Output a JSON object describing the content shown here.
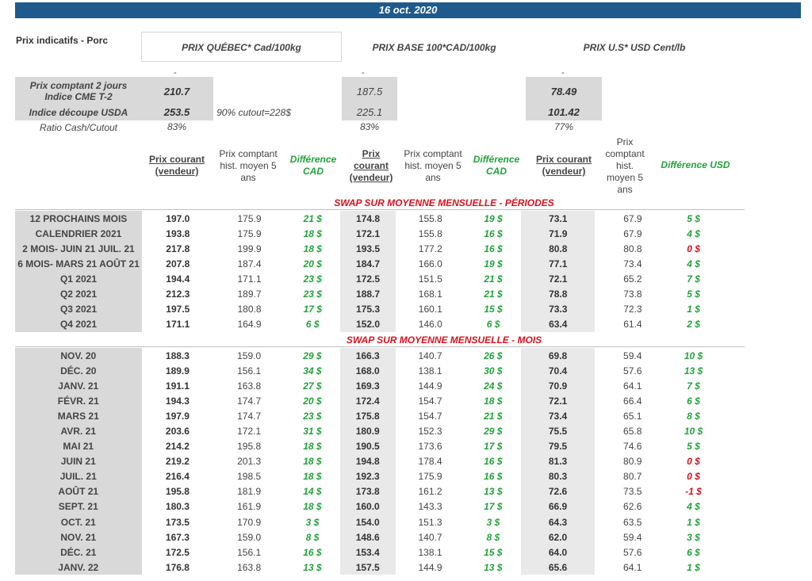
{
  "banner_date": "16 oct. 2020",
  "title_left": "Prix indicatifs - Porc",
  "headers": {
    "quebec": "PRIX QUÉBEC* Cad/100kg",
    "base": "PRIX BASE 100*CAD/100kg",
    "us": "PRIX U.S* USD Cent/lb"
  },
  "top_rows": [
    {
      "label": "Prix comptant 2 jours Indice CME T-2",
      "quebec": "210.7",
      "base": "187.5",
      "us": "78.49"
    },
    {
      "label": "Indice découpe USDA",
      "quebec": "253.5",
      "note": "90% cutout=228$",
      "base": "225.1",
      "us": "101.42"
    },
    {
      "label": "Ratio Cash/Cutout",
      "quebec": "83%",
      "base": "83%",
      "us": "77%"
    }
  ],
  "col_headers": {
    "current_seller": "Prix courant (vendeur)",
    "current_short1": "Prix",
    "current_short2": "courant",
    "current_short3": "(vendeur)",
    "hist_avg": "Prix comptant hist. moyen 5 ans",
    "diff_cad": "Différence CAD",
    "diff_usd": "Différence USD"
  },
  "section_periods": "SWAP SUR MOYENNE MENSUELLE - PÉRIODES",
  "section_months": "SWAP SUR MOYENNE MENSUELLE - MOIS",
  "periods": [
    {
      "label": "12 PROCHAINS MOIS",
      "q": "197.0",
      "qh": "175.9",
      "qd": "21 $",
      "b": "174.8",
      "bh": "155.8",
      "bd": "19 $",
      "u": "73.1",
      "uh": "67.9",
      "ud": "5 $"
    },
    {
      "label": "CALENDRIER 2021",
      "q": "193.8",
      "qh": "175.9",
      "qd": "18 $",
      "b": "172.1",
      "bh": "155.8",
      "bd": "16 $",
      "u": "71.9",
      "uh": "67.9",
      "ud": "4 $"
    },
    {
      "label": "2 MOIS- JUIN 21 JUIL. 21",
      "q": "217.8",
      "qh": "199.9",
      "qd": "18 $",
      "b": "193.5",
      "bh": "177.2",
      "bd": "16 $",
      "u": "80.8",
      "uh": "80.8",
      "ud": "0 $"
    },
    {
      "label": "6 MOIS- MARS 21 AOÛT 21",
      "q": "207.8",
      "qh": "187.4",
      "qd": "20 $",
      "b": "184.7",
      "bh": "166.0",
      "bd": "19 $",
      "u": "77.1",
      "uh": "73.4",
      "ud": "4 $"
    },
    {
      "label": "Q1 2021",
      "q": "194.4",
      "qh": "171.1",
      "qd": "23 $",
      "b": "172.5",
      "bh": "151.5",
      "bd": "21 $",
      "u": "72.1",
      "uh": "65.2",
      "ud": "7 $"
    },
    {
      "label": "Q2 2021",
      "q": "212.3",
      "qh": "189.7",
      "qd": "23 $",
      "b": "188.7",
      "bh": "168.1",
      "bd": "21 $",
      "u": "78.8",
      "uh": "73.8",
      "ud": "5 $"
    },
    {
      "label": "Q3 2021",
      "q": "197.5",
      "qh": "180.8",
      "qd": "17 $",
      "b": "175.3",
      "bh": "160.1",
      "bd": "15 $",
      "u": "73.3",
      "uh": "72.3",
      "ud": "1 $"
    },
    {
      "label": "Q4 2021",
      "q": "171.1",
      "qh": "164.9",
      "qd": "6 $",
      "b": "152.0",
      "bh": "146.0",
      "bd": "6 $",
      "u": "63.4",
      "uh": "61.4",
      "ud": "2 $"
    }
  ],
  "months": [
    {
      "label": "NOV. 20",
      "q": "188.3",
      "qh": "159.0",
      "qd": "29 $",
      "b": "166.3",
      "bh": "140.7",
      "bd": "26 $",
      "u": "69.8",
      "uh": "59.4",
      "ud": "10 $"
    },
    {
      "label": "DÉC. 20",
      "q": "189.9",
      "qh": "156.1",
      "qd": "34 $",
      "b": "168.0",
      "bh": "138.1",
      "bd": "30 $",
      "u": "70.4",
      "uh": "57.6",
      "ud": "13 $"
    },
    {
      "label": "JANV. 21",
      "q": "191.1",
      "qh": "163.8",
      "qd": "27 $",
      "b": "169.3",
      "bh": "144.9",
      "bd": "24 $",
      "u": "70.9",
      "uh": "64.1",
      "ud": "7 $"
    },
    {
      "label": "FÉVR. 21",
      "q": "194.3",
      "qh": "174.7",
      "qd": "20 $",
      "b": "172.4",
      "bh": "154.7",
      "bd": "18 $",
      "u": "72.1",
      "uh": "66.4",
      "ud": "6 $"
    },
    {
      "label": "MARS 21",
      "q": "197.9",
      "qh": "174.7",
      "qd": "23 $",
      "b": "175.8",
      "bh": "154.7",
      "bd": "21 $",
      "u": "73.4",
      "uh": "65.1",
      "ud": "8 $"
    },
    {
      "label": "AVR. 21",
      "q": "203.6",
      "qh": "172.1",
      "qd": "31 $",
      "b": "180.9",
      "bh": "152.3",
      "bd": "29 $",
      "u": "75.5",
      "uh": "65.8",
      "ud": "10 $"
    },
    {
      "label": "MAI 21",
      "q": "214.2",
      "qh": "195.8",
      "qd": "18 $",
      "b": "190.5",
      "bh": "173.6",
      "bd": "17 $",
      "u": "79.5",
      "uh": "74.6",
      "ud": "5 $"
    },
    {
      "label": "JUIN 21",
      "q": "219.2",
      "qh": "201.3",
      "qd": "18 $",
      "b": "194.8",
      "bh": "178.4",
      "bd": "16 $",
      "u": "81.3",
      "uh": "80.9",
      "ud": "0 $"
    },
    {
      "label": "JUIL. 21",
      "q": "216.4",
      "qh": "198.5",
      "qd": "18 $",
      "b": "192.3",
      "bh": "175.9",
      "bd": "16 $",
      "u": "80.3",
      "uh": "80.7",
      "ud": "0 $"
    },
    {
      "label": "AOÛT 21",
      "q": "195.8",
      "qh": "181.9",
      "qd": "14 $",
      "b": "173.8",
      "bh": "161.2",
      "bd": "13 $",
      "u": "72.6",
      "uh": "73.5",
      "ud": "-1 $"
    },
    {
      "label": "SEPT. 21",
      "q": "180.3",
      "qh": "161.9",
      "qd": "18 $",
      "b": "160.0",
      "bh": "143.3",
      "bd": "17 $",
      "u": "66.9",
      "uh": "62.6",
      "ud": "4 $"
    },
    {
      "label": "OCT. 21",
      "q": "173.5",
      "qh": "170.9",
      "qd": "3 $",
      "b": "154.0",
      "bh": "151.3",
      "bd": "3 $",
      "u": "64.3",
      "uh": "63.5",
      "ud": "1 $"
    },
    {
      "label": "NOV. 21",
      "q": "167.3",
      "qh": "159.0",
      "qd": "8 $",
      "b": "148.6",
      "bh": "140.7",
      "bd": "8 $",
      "u": "62.0",
      "uh": "59.4",
      "ud": "3 $"
    },
    {
      "label": "DÉC. 21",
      "q": "172.5",
      "qh": "156.1",
      "qd": "16 $",
      "b": "153.4",
      "bh": "138.1",
      "bd": "15 $",
      "u": "64.0",
      "uh": "57.6",
      "ud": "6 $"
    },
    {
      "label": "JANV. 22",
      "q": "176.8",
      "qh": "163.8",
      "qd": "13 $",
      "b": "157.5",
      "bh": "144.9",
      "bd": "13 $",
      "u": "65.6",
      "uh": "64.1",
      "ud": "1 $"
    }
  ],
  "negative_color": "#d9131f",
  "positive_color": "#22a33a"
}
